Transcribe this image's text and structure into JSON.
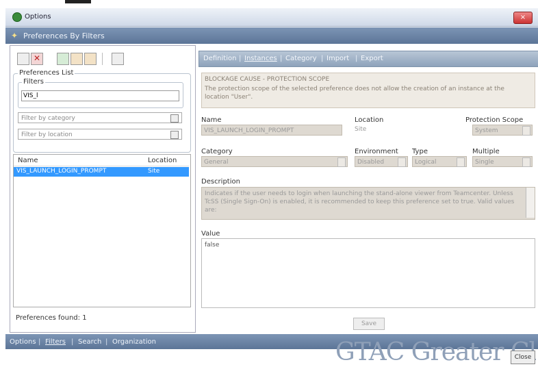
{
  "window": {
    "title": "Options",
    "close_glyph": "×"
  },
  "header": {
    "title": "Preferences By Filters"
  },
  "left": {
    "toolbar_icons": [
      "copy-icon",
      "delete-icon",
      "import-icon",
      "export-icon",
      "chart-icon",
      "list-icon"
    ],
    "preferences_list_label": "Preferences List",
    "filters_label": "Filters",
    "filter_value": "VIS_l",
    "category_placeholder": "Filter by category",
    "location_placeholder": "Filter by location",
    "table": {
      "columns": [
        "Name",
        "Location"
      ],
      "rows": [
        {
          "name": "VIS_LAUNCH_LOGIN_PROMPT",
          "location": "Site"
        }
      ]
    },
    "found_text": "Preferences found: 1"
  },
  "right": {
    "tabs": [
      "Definition",
      "Instances",
      "Category",
      "Import",
      "Export"
    ],
    "active_tab": "Instances",
    "warning_title": "BLOCKAGE CAUSE - PROTECTION SCOPE",
    "warning_text": "The protection scope of the selected preference does not allow the creation of an instance at the location \"User\".",
    "name_label": "Name",
    "name_value": "VIS_LAUNCH_LOGIN_PROMPT",
    "location_label": "Location",
    "location_value": "Site",
    "scope_label": "Protection Scope",
    "scope_value": "System",
    "category_label": "Category",
    "category_value": "General",
    "environment_label": "Environment",
    "environment_value": "Disabled",
    "type_label": "Type",
    "type_value": "Logical",
    "multiple_label": "Multiple",
    "multiple_value": "Single",
    "description_label": "Description",
    "description_text": "Indicates if the user needs to login when launching the stand-alone viewer from Teamcenter. Unless TcSS (Single Sign-On) is enabled, it is recommended to keep this preference set to true. Valid values are:",
    "value_label": "Value",
    "value_text": "false",
    "save_label": "Save"
  },
  "bottom_nav": {
    "items": [
      "Options",
      "Filters",
      "Search",
      "Organization"
    ],
    "active": "Filters"
  },
  "footer": {
    "watermark": "GTAC Greater Cl",
    "close_label": "Close"
  }
}
